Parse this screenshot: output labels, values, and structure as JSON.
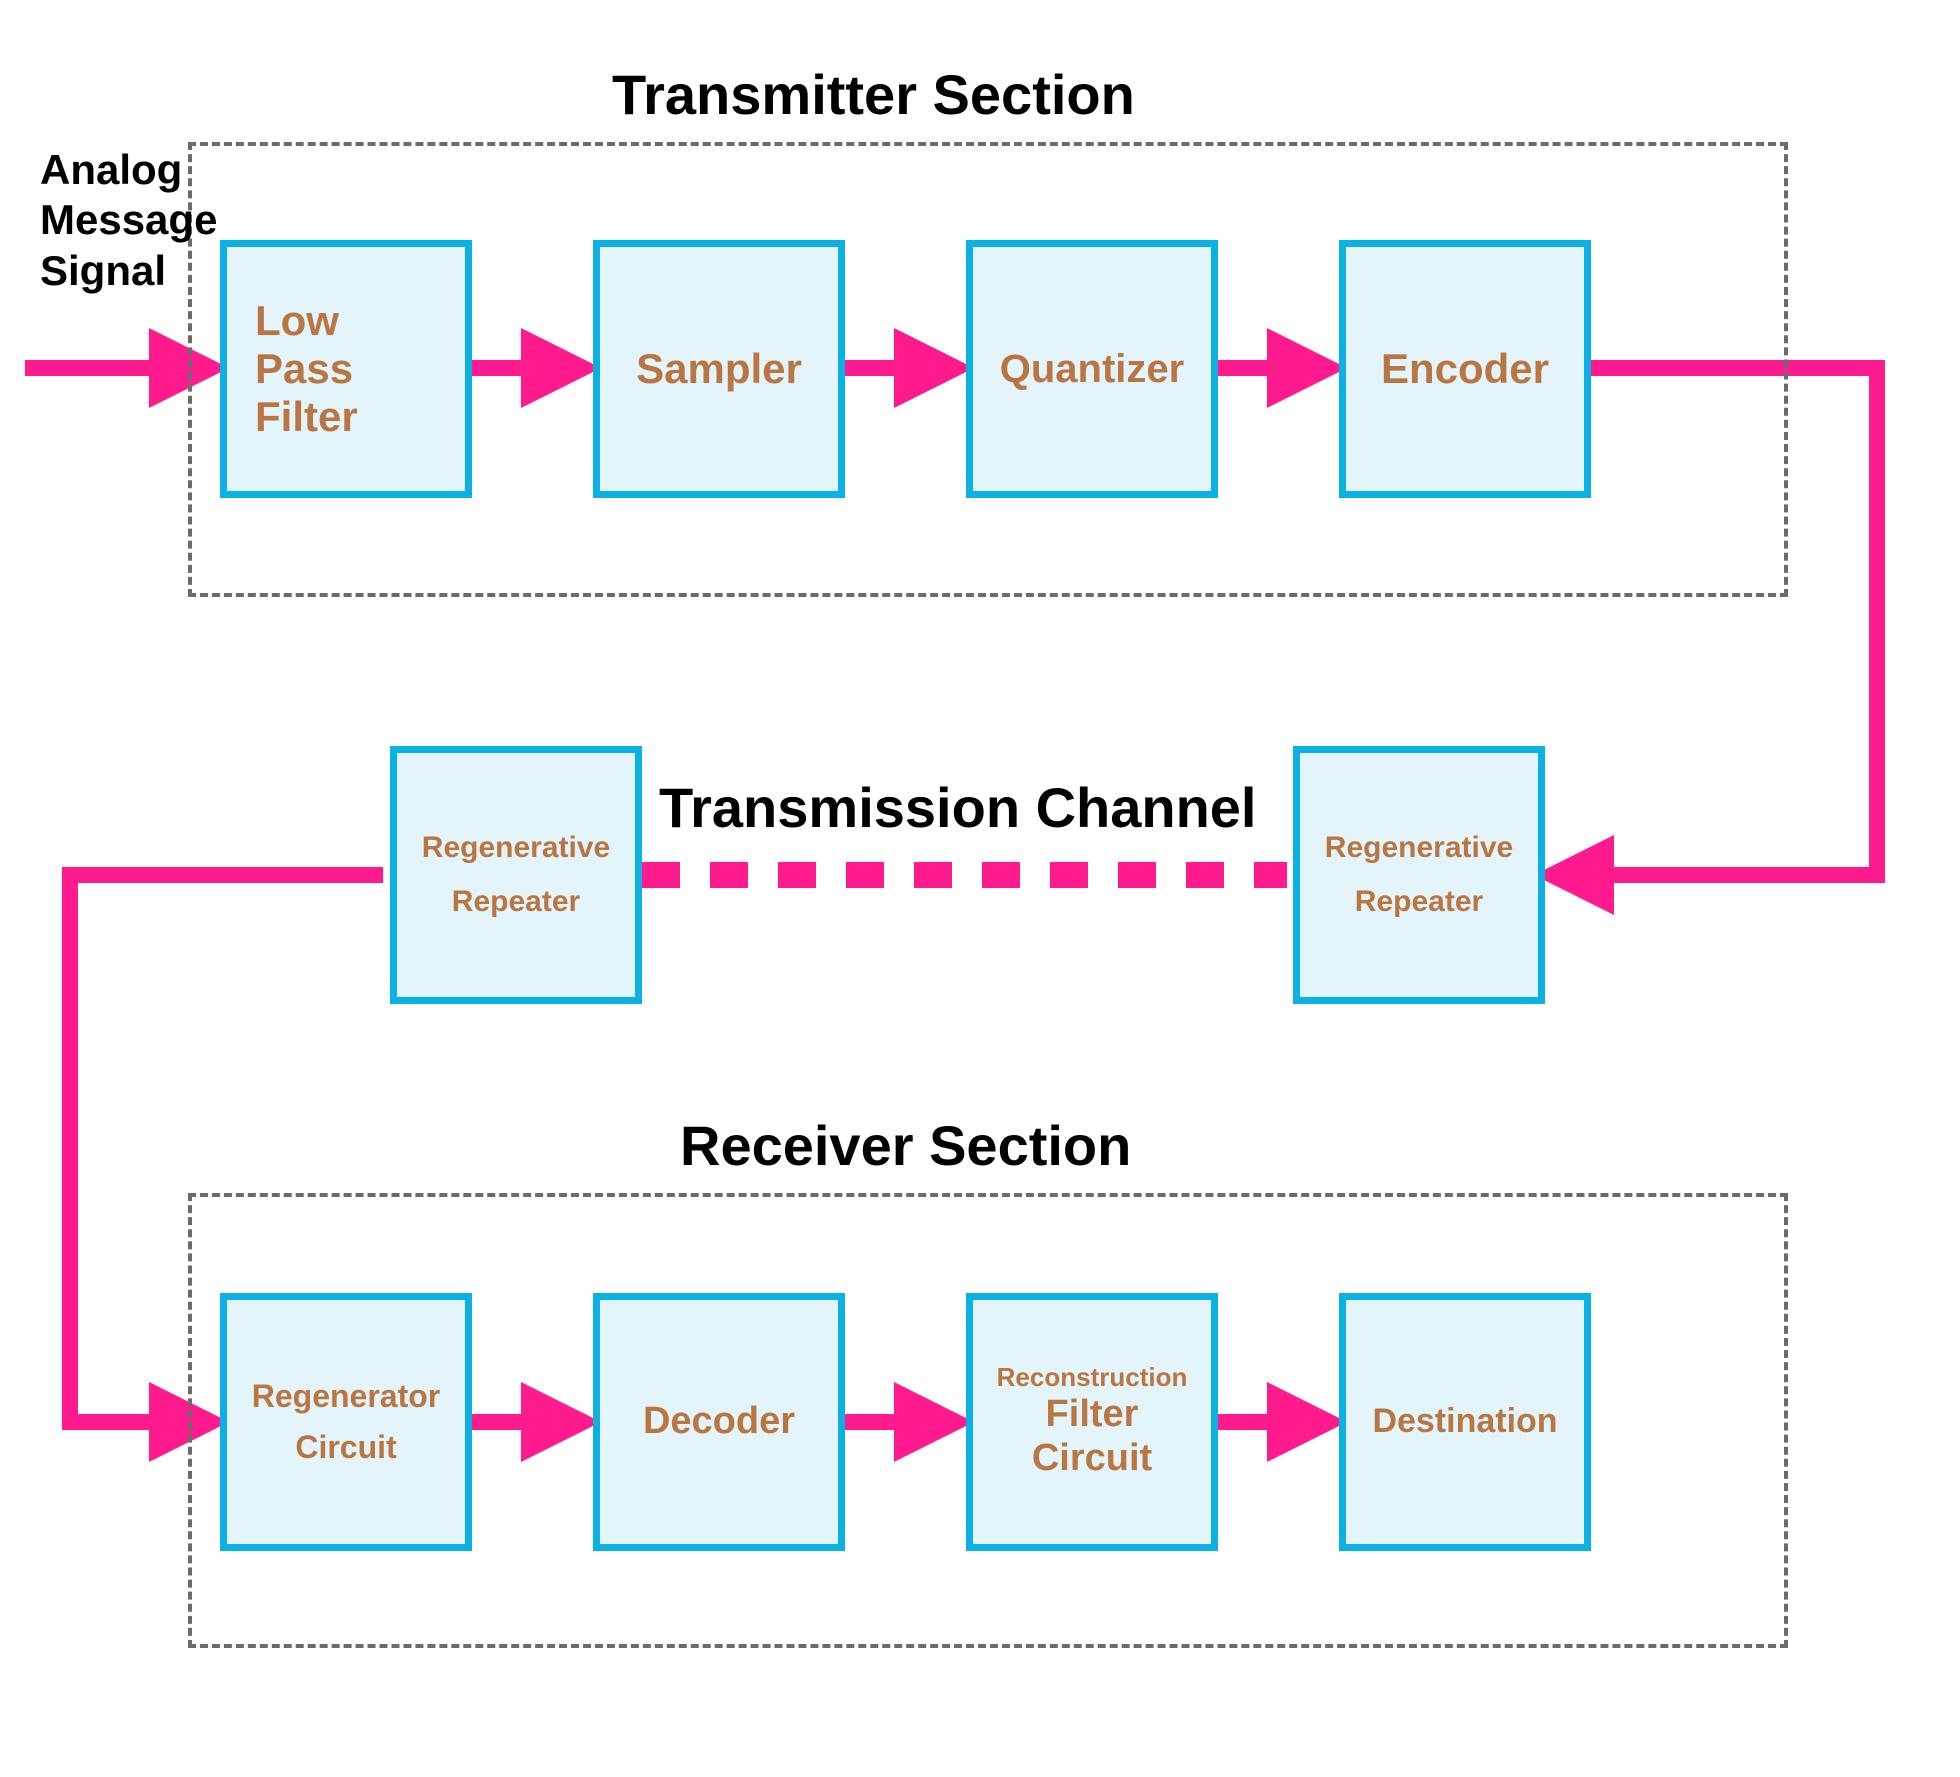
{
  "input_label": "Analog\nMessage\nSignal",
  "sections": {
    "transmitter": "Transmitter Section",
    "channel": "Transmission Channel",
    "receiver": "Receiver Section"
  },
  "blocks": {
    "lpf": "Low\nPass\nFilter",
    "sampler": "Sampler",
    "quantizer": "Quantizer",
    "encoder": "Encoder",
    "rep1": "Regenerative\nRepeater",
    "rep2": "Regenerative\nRepeater",
    "regen": "Regenerator\nCircuit",
    "decoder": "Decoder",
    "reconFilter": "Reconstruction\nFilter\nCircuit",
    "dest": "Destination"
  },
  "colors": {
    "arrow": "#ff1b8d",
    "box_border": "#0bb1e3",
    "box_fill": "#e3f4fb",
    "block_text": "#b97642",
    "dash": "#6b6b6b"
  }
}
